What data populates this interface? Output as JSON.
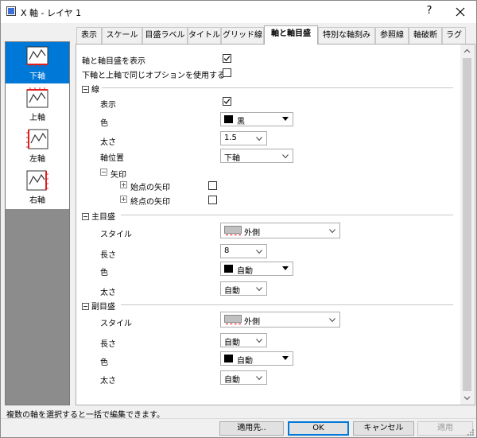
{
  "window": {
    "title": "X 軸 - レイヤ 1",
    "help_label": "?"
  },
  "tabs": [
    {
      "label": "表示",
      "active": false
    },
    {
      "label": "スケール",
      "active": false
    },
    {
      "label": "目盛ラベル",
      "active": false
    },
    {
      "label": "タイトル",
      "active": false
    },
    {
      "label": "グリッド線",
      "active": false
    },
    {
      "label": "軸と軸目盛",
      "active": true
    },
    {
      "label": "特別な軸刻み",
      "active": false
    },
    {
      "label": "参照線",
      "active": false
    },
    {
      "label": "軸破断",
      "active": false
    },
    {
      "label": "ラグ",
      "active": false
    }
  ],
  "axes": [
    {
      "label": "下軸",
      "selected": true
    },
    {
      "label": "上軸",
      "selected": false
    },
    {
      "label": "左軸",
      "selected": false
    },
    {
      "label": "右軸",
      "selected": false
    }
  ],
  "options": {
    "show_axis": {
      "label": "軸と軸目盛を表示",
      "checked": true
    },
    "same_options": {
      "label": "下軸と上軸で同じオプションを使用する",
      "checked": false
    }
  },
  "line": {
    "heading": "線",
    "show_label": "表示",
    "show_checked": true,
    "color_label": "色",
    "color_value": "黒",
    "thickness_label": "太さ",
    "thickness_value": "1.5",
    "position_label": "軸位置",
    "position_value": "下軸",
    "arrow_label": "矢印",
    "arrow_start_label": "始点の矢印",
    "arrow_start_checked": false,
    "arrow_end_label": "終点の矢印",
    "arrow_end_checked": false
  },
  "major_ticks": {
    "heading": "主目盛",
    "style_label": "スタイル",
    "style_value": "外側",
    "length_label": "長さ",
    "length_value": "8",
    "color_label": "色",
    "color_value": "自動",
    "thickness_label": "太さ",
    "thickness_value": "自動"
  },
  "minor_ticks": {
    "heading": "副目盛",
    "style_label": "スタイル",
    "style_value": "外側",
    "length_label": "長さ",
    "length_value": "自動",
    "color_label": "色",
    "color_value": "自動",
    "thickness_label": "太さ",
    "thickness_value": "自動"
  },
  "status": {
    "text": "複数の軸を選択すると一括で編集できます。"
  },
  "buttons": {
    "apply_to": "適用先..",
    "ok": "OK",
    "cancel": "キャンセル",
    "apply": "適用"
  },
  "colors": {
    "accent": "#0078d7",
    "panel_gray": "#8c8c8c",
    "axis_red": "#e02020"
  },
  "icons": [
    "app-icon",
    "close-icon",
    "axis-bottom-icon",
    "axis-top-icon",
    "axis-left-icon",
    "axis-right-icon",
    "checkmark-icon",
    "chevron-down-icon"
  ]
}
